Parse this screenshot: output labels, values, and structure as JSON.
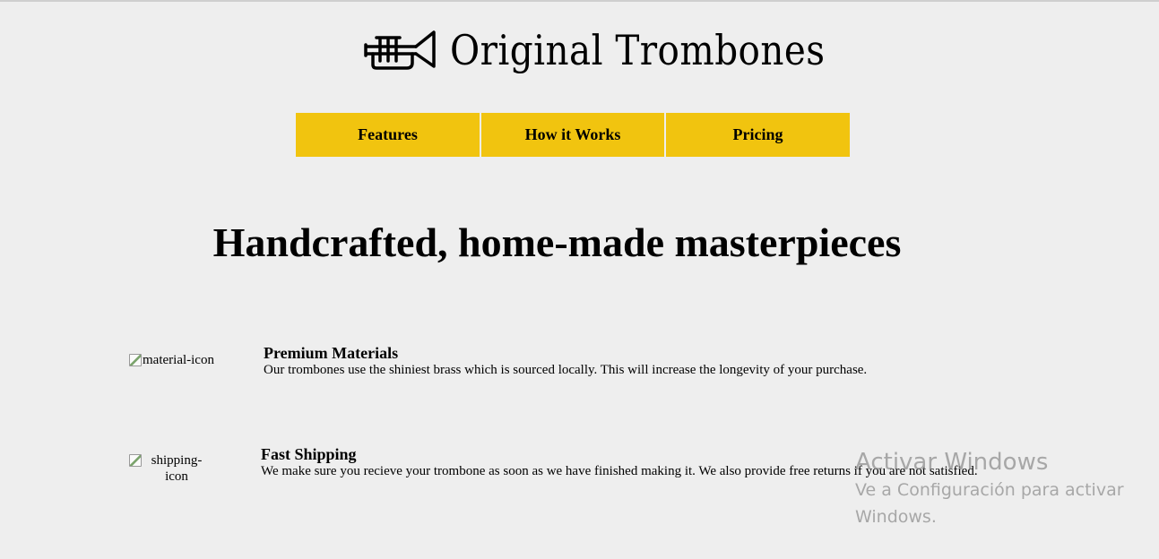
{
  "header": {
    "logo_icon": "trumpet-icon",
    "brand_name": "Original Trombones"
  },
  "nav": {
    "items": [
      {
        "label": "Features"
      },
      {
        "label": "How it Works"
      },
      {
        "label": "Pricing"
      }
    ],
    "accent_color": "#f1c40f"
  },
  "hero": {
    "title": "Handcrafted, home-made masterpieces"
  },
  "features": [
    {
      "image_alt": "material-icon",
      "title": "Premium Materials",
      "description": "Our trombones use the shiniest brass which is sourced locally. This will increase the longevity of your purchase."
    },
    {
      "image_alt": "shipping-icon",
      "title": "Fast Shipping",
      "description": "We make sure you recieve your trombone as soon as we have finished making it. We also provide free returns if you are not satisfied."
    }
  ],
  "os_watermark": {
    "title": "Activar Windows",
    "subtitle": "Ve a Configuración para activar Windows."
  },
  "colors": {
    "background": "#eeeeee",
    "text": "#000000"
  }
}
